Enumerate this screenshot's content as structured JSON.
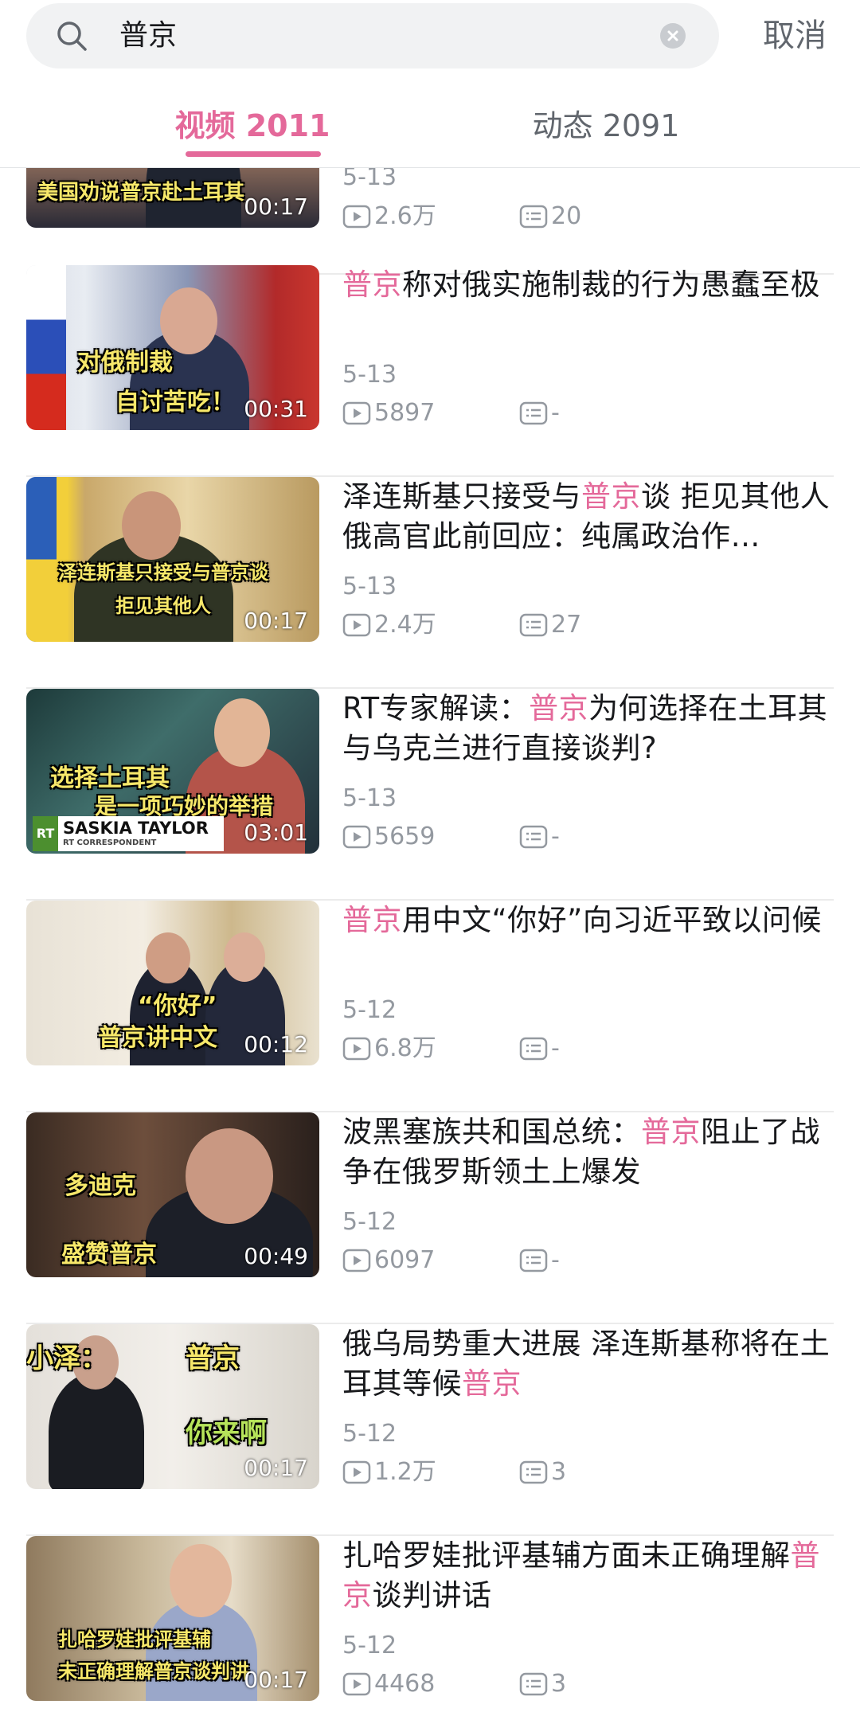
{
  "search": {
    "query": "普京",
    "cancel_label": "取消"
  },
  "tabs": [
    {
      "label": "视频 2011",
      "active": true
    },
    {
      "label": "动态 2091",
      "active": false
    }
  ],
  "colors": {
    "accent": "#e4699a",
    "muted": "#9499a0",
    "text": "#18191c"
  },
  "items": [
    {
      "thumb_caption": [
        "美国劝说普京赴土耳其"
      ],
      "duration": "00:17",
      "title_parts": [],
      "date": "5-13",
      "plays": "2.6万",
      "comments": "20"
    },
    {
      "thumb_caption": [
        "对俄制裁",
        "自讨苦吃！"
      ],
      "duration": "00:31",
      "title_parts": [
        {
          "t": "普京",
          "hl": true
        },
        {
          "t": "称对俄实施制裁的行为愚蠢至极",
          "hl": false
        }
      ],
      "date": "5-13",
      "plays": "5897",
      "comments": "-"
    },
    {
      "thumb_caption": [
        "泽连斯基只接受与普京谈",
        "拒见其他人"
      ],
      "duration": "00:17",
      "title_parts": [
        {
          "t": "泽连斯基只接受与",
          "hl": false
        },
        {
          "t": "普京",
          "hl": true
        },
        {
          "t": "谈 拒见其他人俄高官此前回应：纯属政治作…",
          "hl": false
        }
      ],
      "date": "5-13",
      "plays": "2.4万",
      "comments": "27"
    },
    {
      "thumb_caption": [
        "选择土耳其",
        "是一项巧妙的举措",
        "SASKIA TAYLOR",
        "RT CORRESPONDENT"
      ],
      "duration": "03:01",
      "title_parts": [
        {
          "t": "RT专家解读：",
          "hl": false
        },
        {
          "t": "普京",
          "hl": true
        },
        {
          "t": "为何选择在土耳其与乌克兰进行直接谈判?",
          "hl": false
        }
      ],
      "date": "5-13",
      "plays": "5659",
      "comments": "-"
    },
    {
      "thumb_caption": [
        "“你好”",
        "普京讲中文"
      ],
      "duration": "00:12",
      "title_parts": [
        {
          "t": "普京",
          "hl": true
        },
        {
          "t": "用中文“你好”向习近平致以问候",
          "hl": false
        }
      ],
      "date": "5-12",
      "plays": "6.8万",
      "comments": "-"
    },
    {
      "thumb_caption": [
        "多迪克",
        "盛赞普京"
      ],
      "duration": "00:49",
      "title_parts": [
        {
          "t": "波黑塞族共和国总统：",
          "hl": false
        },
        {
          "t": "普京",
          "hl": true
        },
        {
          "t": "阻止了战争在俄罗斯领土上爆发",
          "hl": false
        }
      ],
      "date": "5-12",
      "plays": "6097",
      "comments": "-"
    },
    {
      "thumb_caption": [
        "小泽：",
        "普京",
        "你来啊"
      ],
      "duration": "00:17",
      "title_parts": [
        {
          "t": "俄乌局势重大进展 泽连斯基称将在土耳其等候",
          "hl": false
        },
        {
          "t": "普京",
          "hl": true
        }
      ],
      "date": "5-12",
      "plays": "1.2万",
      "comments": "3"
    },
    {
      "thumb_caption": [
        "扎哈罗娃批评基辅",
        "未正确理解普京谈判讲"
      ],
      "duration": "00:17",
      "title_parts": [
        {
          "t": "扎哈罗娃批评基辅方面未正确理解",
          "hl": false
        },
        {
          "t": "普京",
          "hl": true
        },
        {
          "t": "谈判讲话",
          "hl": false
        }
      ],
      "date": "5-12",
      "plays": "4468",
      "comments": "3"
    }
  ]
}
